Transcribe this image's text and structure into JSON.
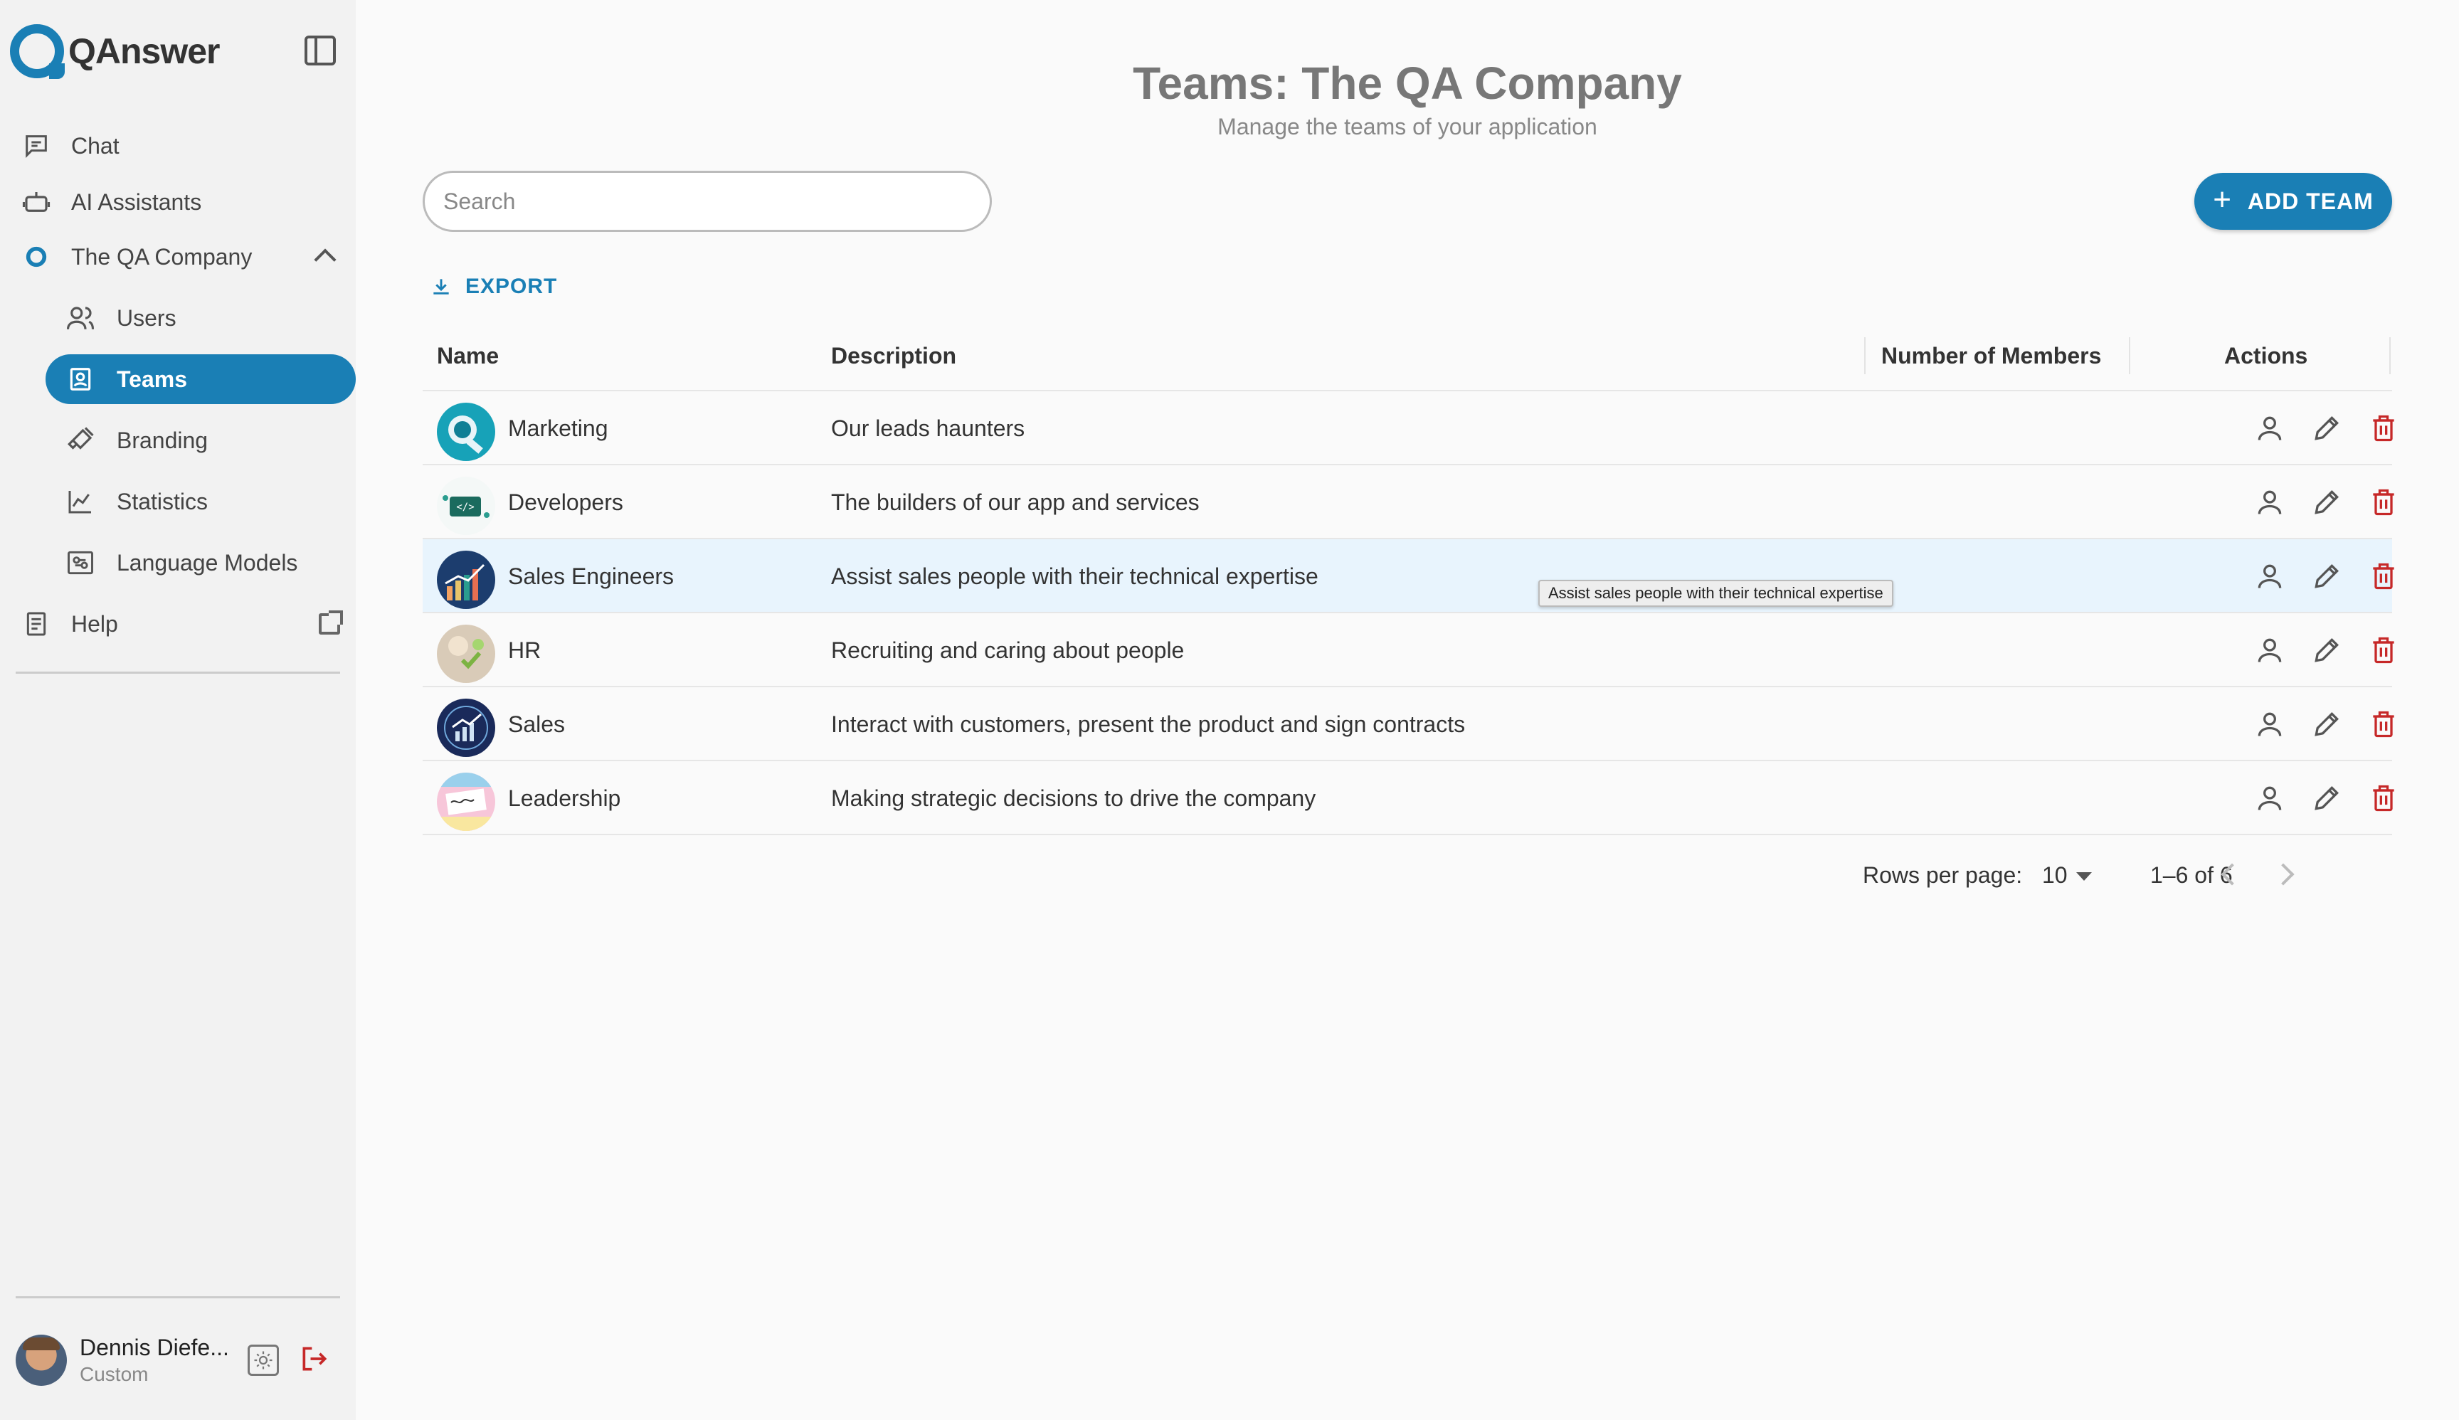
{
  "brand": {
    "name": "QAnswer"
  },
  "sidebar": {
    "items": [
      {
        "label": "Chat",
        "icon": "chat-icon"
      },
      {
        "label": "AI Assistants",
        "icon": "robot-icon"
      },
      {
        "label": "The QA Company",
        "icon": "org-logo-icon"
      },
      {
        "label": "Users",
        "icon": "users-icon"
      },
      {
        "label": "Teams",
        "icon": "team-card-icon",
        "active": true
      },
      {
        "label": "Branding",
        "icon": "brush-icon"
      },
      {
        "label": "Statistics",
        "icon": "chart-icon"
      },
      {
        "label": "Language Models",
        "icon": "model-icon"
      },
      {
        "label": "Help",
        "icon": "help-book-icon"
      }
    ]
  },
  "user": {
    "name": "Dennis Diefe...",
    "role": "Custom"
  },
  "header": {
    "title": "Teams: The QA Company",
    "subtitle": "Manage the teams of your application"
  },
  "search": {
    "placeholder": "Search",
    "value": ""
  },
  "toolbar": {
    "add_label": "ADD TEAM",
    "export_label": "EXPORT"
  },
  "table": {
    "columns": [
      "Name",
      "Description",
      "Number of Members",
      "Actions"
    ],
    "rows": [
      {
        "name": "Marketing",
        "description": "Our leads haunters",
        "members": ""
      },
      {
        "name": "Developers",
        "description": "The builders of our app and services",
        "members": ""
      },
      {
        "name": "Sales Engineers",
        "description": "Assist sales people with their technical expertise",
        "members": ""
      },
      {
        "name": "HR",
        "description": "Recruiting and caring about people",
        "members": ""
      },
      {
        "name": "Sales",
        "description": "Interact with customers, present the product and sign contracts",
        "members": ""
      },
      {
        "name": "Leadership",
        "description": "Making strategic decisions to drive the company",
        "members": ""
      }
    ]
  },
  "tooltip": {
    "text": "Assist sales people with their technical expertise"
  },
  "pagination": {
    "rows_per_page_label": "Rows per page:",
    "rows_per_page": "10",
    "range": "1–6 of 6"
  },
  "colors": {
    "accent": "#1a7fb5",
    "danger": "#c62828",
    "hover_row": "#e8f4fd",
    "sidebar_bg": "#f2f2f2"
  }
}
